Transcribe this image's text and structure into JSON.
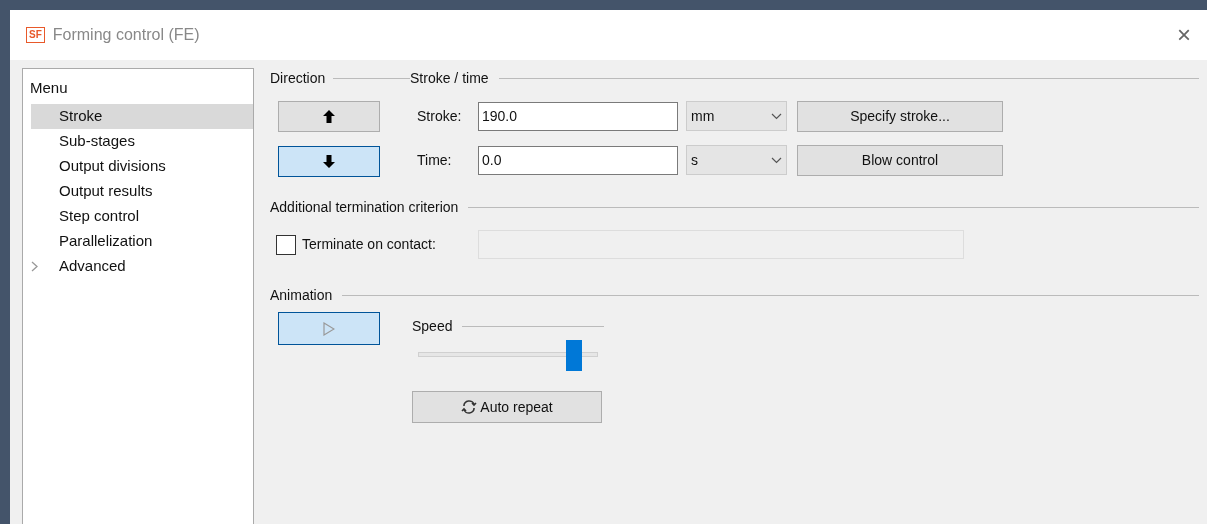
{
  "window": {
    "logo": "SF",
    "title": "Forming control (FE)",
    "close": "×"
  },
  "sidebar": {
    "title": "Menu",
    "items": [
      {
        "label": "Stroke",
        "selected": true,
        "expandable": false
      },
      {
        "label": "Sub-stages",
        "selected": false,
        "expandable": false
      },
      {
        "label": "Output divisions",
        "selected": false,
        "expandable": false
      },
      {
        "label": "Output results",
        "selected": false,
        "expandable": false
      },
      {
        "label": "Step control",
        "selected": false,
        "expandable": false
      },
      {
        "label": "Parallelization",
        "selected": false,
        "expandable": false
      },
      {
        "label": "Advanced",
        "selected": false,
        "expandable": true
      }
    ]
  },
  "direction": {
    "title": "Direction",
    "buttons": [
      {
        "kind": "up",
        "selected": false
      },
      {
        "kind": "down",
        "selected": true
      }
    ]
  },
  "stroke_time": {
    "title": "Stroke / time",
    "rows": [
      {
        "label": "Stroke:",
        "value": "190.0",
        "unit": "mm",
        "button": "Specify stroke..."
      },
      {
        "label": "Time:",
        "value": "0.0",
        "unit": "s",
        "button": "Blow control"
      }
    ]
  },
  "termination": {
    "title": "Additional termination criterion",
    "checkbox": {
      "label": "Terminate on contact:",
      "checked": false
    }
  },
  "animation": {
    "title": "Animation",
    "play": {
      "active": true
    },
    "speed": {
      "title": "Speed",
      "level": 0.9
    },
    "auto_repeat": "Auto repeat"
  }
}
